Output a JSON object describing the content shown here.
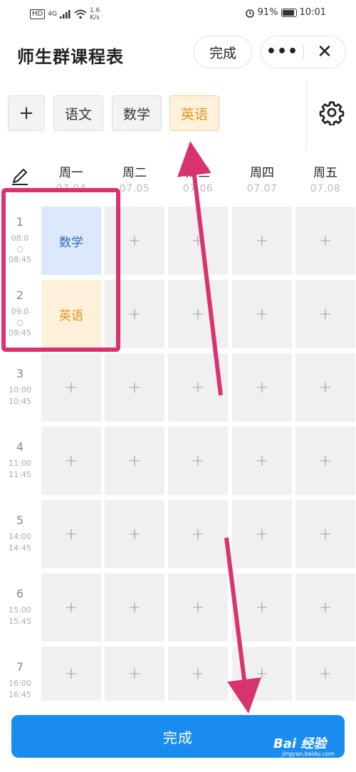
{
  "status_bar": {
    "network": "HD",
    "signal": "4G",
    "speed_value": "1.6",
    "speed_unit": "K/s",
    "battery": "91%",
    "time": "10:01"
  },
  "header": {
    "title": "师生群课程表",
    "done_label": "完成",
    "more_label": "•••",
    "close_label": "✕"
  },
  "subjects": {
    "add_label": "+",
    "items": [
      "语文",
      "数学",
      "英语"
    ]
  },
  "days": [
    {
      "name": "周一",
      "date": "07.04"
    },
    {
      "name": "周二",
      "date": "07.05"
    },
    {
      "name": "周三",
      "date": "07.06"
    },
    {
      "name": "周四",
      "date": "07.07"
    },
    {
      "name": "周五",
      "date": "07.08"
    }
  ],
  "periods": [
    {
      "num": "1",
      "start": "08:0",
      "sep": "○",
      "end": "08:45"
    },
    {
      "num": "2",
      "start": "09:0",
      "sep": "○",
      "end": "09:45"
    },
    {
      "num": "3",
      "start": "10:00",
      "end": "10:45"
    },
    {
      "num": "4",
      "start": "11:00",
      "end": "11:45"
    },
    {
      "num": "5",
      "start": "14:00",
      "end": "14:45"
    },
    {
      "num": "6",
      "start": "15:00",
      "end": "15:45"
    },
    {
      "num": "7",
      "start": "16:00",
      "end": "16:45"
    }
  ],
  "cells": {
    "empty": "+",
    "math": "数学",
    "english": "英语"
  },
  "bottom_button": "完成",
  "watermark": {
    "brand": "Bai 经验",
    "url": "jingyan.baidu.com"
  },
  "colors": {
    "primary": "#1a8cf0",
    "annotation": "#d9336f",
    "math_bg": "#dce8fb",
    "english_bg": "#fff0dc"
  }
}
